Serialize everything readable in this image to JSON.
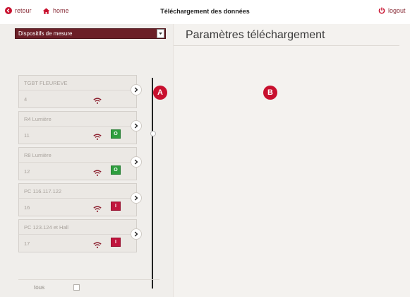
{
  "header": {
    "back_label": "retour",
    "home_label": "home",
    "title": "Téléchargement des données",
    "logout_label": "logout",
    "accent_color": "#c8102e"
  },
  "left_panel": {
    "selector": {
      "selected": "Dispositifs de mesure"
    },
    "devices": [
      {
        "name": "TGBT FLEUREVE",
        "number": "4",
        "status": null,
        "icon": "wifi-icon"
      },
      {
        "name": "R4 Lumière",
        "number": "11",
        "status": "O",
        "status_color": "#2e9e3e",
        "icon": "wifi-icon"
      },
      {
        "name": "R8 Lumière",
        "number": "12",
        "status": "O",
        "status_color": "#2e9e3e",
        "icon": "wifi-icon"
      },
      {
        "name": "PC 116.117.122",
        "number": "16",
        "status": "I",
        "status_color": "#c0143c",
        "icon": "wifi-icon"
      },
      {
        "name": "PC 123.124 et Hall",
        "number": "17",
        "status": "I",
        "status_color": "#c0143c",
        "icon": "wifi-icon"
      }
    ],
    "select_all_label": "tous"
  },
  "right_panel": {
    "title": "Paramètres téléchargement"
  },
  "markers": {
    "a": "A",
    "b": "B"
  }
}
